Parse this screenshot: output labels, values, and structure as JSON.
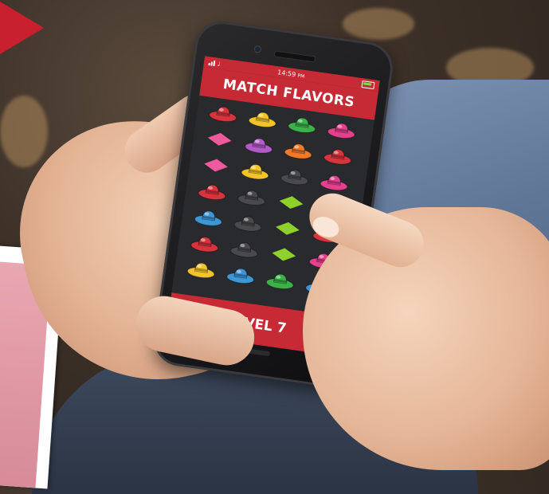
{
  "game": {
    "title": "MATCH FLAVORS",
    "level_label": "LEVEL 7",
    "time": "14:59",
    "time_suffix": "PM"
  },
  "board": {
    "rows": [
      [
        "red",
        "yellow",
        "green",
        "pink"
      ],
      [
        "pink-diamond",
        "purple",
        "orange",
        "red"
      ],
      [
        "pink-diamond",
        "yellow",
        "black",
        "pink"
      ],
      [
        "red",
        "black",
        "green-diamond",
        "pink"
      ],
      [
        "blue",
        "black",
        "green-diamond",
        "red"
      ],
      [
        "red",
        "black",
        "green-diamond",
        "pink"
      ],
      [
        "yellow",
        "blue",
        "green",
        "blue"
      ]
    ]
  },
  "colors": {
    "accent": "#c62a35",
    "red": "#d8343e",
    "yellow": "#f2c42a",
    "green": "#3cb14a",
    "pink": "#e4408e",
    "purple": "#b25ac8",
    "orange": "#ef7a2a",
    "black": "#4a4a4e",
    "blue": "#3d96d6",
    "pink-diamond": "#ee5a9c",
    "green-diamond": "#8fd12a"
  }
}
